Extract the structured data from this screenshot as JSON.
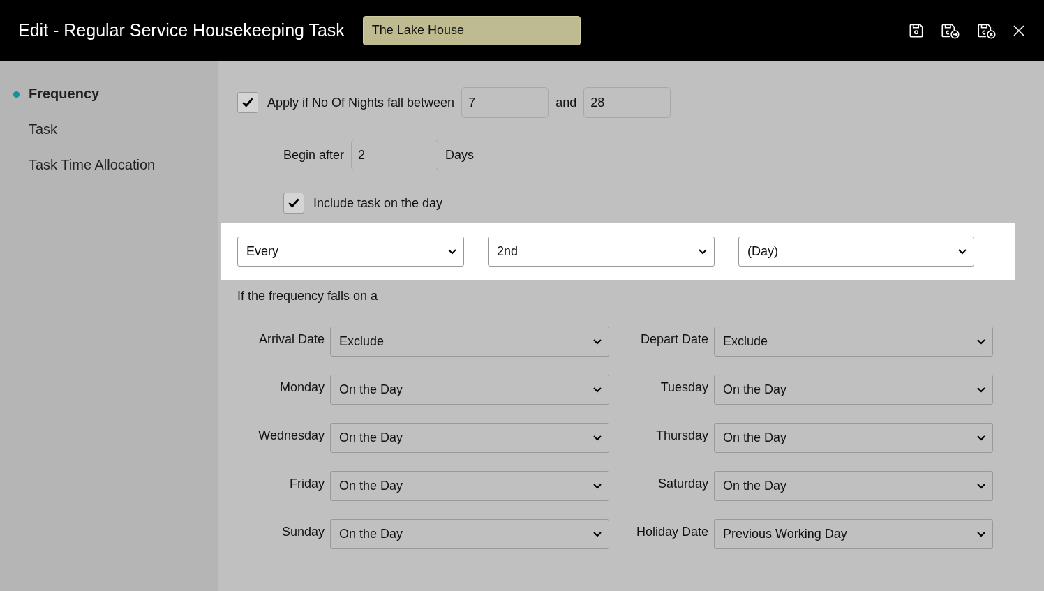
{
  "window": {
    "title": "Edit - Regular Service Housekeeping Task",
    "property": "The Lake House"
  },
  "sidebar": {
    "items": [
      {
        "label": "Frequency",
        "selected": true
      },
      {
        "label": "Task",
        "selected": false
      },
      {
        "label": "Task Time Allocation",
        "selected": false
      }
    ]
  },
  "nights": {
    "checked": true,
    "label": "Apply if No Of Nights fall between",
    "from": "7",
    "joiner": "and",
    "to": "28"
  },
  "begin": {
    "label": "Begin after",
    "value": "2",
    "unit": "Days"
  },
  "include": {
    "checked": true,
    "label": "Include task on the day"
  },
  "frequency": [
    "Every",
    "2nd",
    "(Day)"
  ],
  "conditions": {
    "heading": "If the frequency falls on a",
    "rows": [
      {
        "label": "Arrival Date",
        "value": "Exclude"
      },
      {
        "label": "Depart Date",
        "value": "Exclude"
      },
      {
        "label": "Monday",
        "value": "On the Day"
      },
      {
        "label": "Tuesday",
        "value": "On the Day"
      },
      {
        "label": "Wednesday",
        "value": "On the Day"
      },
      {
        "label": "Thursday",
        "value": "On the Day"
      },
      {
        "label": "Friday",
        "value": "On the Day"
      },
      {
        "label": "Saturday",
        "value": "On the Day"
      },
      {
        "label": "Sunday",
        "value": "On the Day"
      },
      {
        "label": "Holiday Date",
        "value": "Previous Working Day"
      }
    ]
  }
}
